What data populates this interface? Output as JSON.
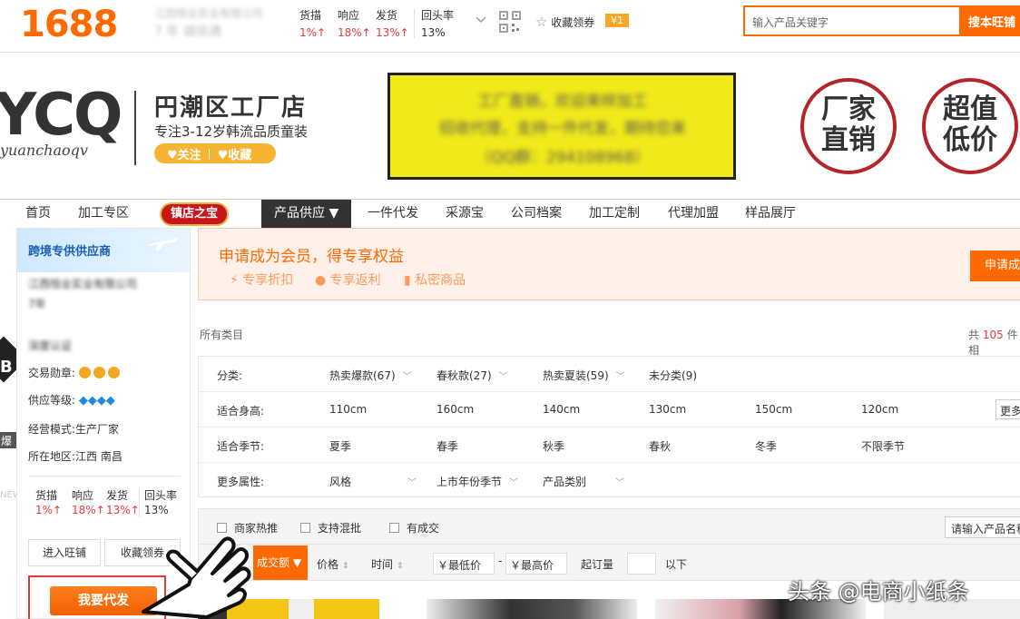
{
  "topbar": {
    "logo": "1688",
    "company_blurred": "江西恒业实业有限公司",
    "company_sub_blurred": "7 年  诚信通",
    "metrics": [
      {
        "label": "货描",
        "value": "1%↑"
      },
      {
        "label": "响应",
        "value": "18%↑"
      },
      {
        "label": "发货",
        "value": "13%↑"
      },
      {
        "label": "回头率",
        "value": "13%"
      }
    ],
    "favorite_label": "收藏领券",
    "coupon": "¥1",
    "search_placeholder": "输入产品关键字",
    "search_button": "搜本旺铺"
  },
  "banner": {
    "brand_big": "YCQ",
    "brand_script": "yuanchaoqv",
    "shop_name": "円潮区工厂店",
    "shop_desc": "专注3-12岁韩流品质童装",
    "follow": "♥关注",
    "collect": "♥收藏",
    "notice_lines_blurred": [
      "工厂直销，欢迎来样加工",
      "招收代理，支持一件代发，期待您来",
      "（QQ群：294108968）"
    ],
    "circle1": [
      "厂家",
      "直销"
    ],
    "circle2": [
      "超值",
      "低价"
    ]
  },
  "nav": {
    "items": [
      "首页",
      "加工专区",
      "镇店之宝",
      "产品供应 ▼",
      "一件代发",
      "采源宝",
      "公司档案",
      "加工定制",
      "代理加盟",
      "样品展厅"
    ]
  },
  "sidebar": {
    "header": "跨境专供供应商",
    "company_blurred": "江西恒业实业有限公司",
    "years_blurred": "7年",
    "license_blurred": "深度认证",
    "trade_medal_label": "交易勋章:",
    "supply_level_label": "供应等级:",
    "biz_mode": "经营模式:生产厂家",
    "location": "所在地区:江西 南昌",
    "metrics": [
      {
        "label": "货描",
        "value": "1%↑"
      },
      {
        "label": "响应",
        "value": "18%↑"
      },
      {
        "label": "发货",
        "value": "13%↑"
      },
      {
        "label": "回头率",
        "value": "13%"
      }
    ],
    "btn_wangpu": "进入旺铺",
    "btn_fav": "收藏领券",
    "btn_daifa": "我要代发",
    "edge_letter": "B",
    "edge_text1": "爆",
    "edge_text2": "NEW"
  },
  "promo": {
    "title": "申请成为会员，得专享权益",
    "perks": [
      "专享折扣",
      "专享返利",
      "私密商品"
    ],
    "button": "申请成"
  },
  "catalog": {
    "crumb": "所有类目",
    "total_prefix": "共",
    "total_count": "105",
    "total_suffix": "件相"
  },
  "filters": {
    "rows": [
      {
        "label": "分类:",
        "values": [
          "热卖爆款(67)",
          "春秋款(27)",
          "热卖夏装(59)",
          "未分类(9)"
        ]
      },
      {
        "label": "适合身高:",
        "values": [
          "110cm",
          "160cm",
          "140cm",
          "130cm",
          "150cm",
          "120cm"
        ],
        "more": "更多"
      },
      {
        "label": "适合季节:",
        "values": [
          "夏季",
          "春季",
          "秋季",
          "春秋",
          "冬季",
          "不限季节"
        ]
      },
      {
        "label": "更多属性:",
        "values": [
          "风格",
          "上市年份季节",
          "产品类别"
        ]
      }
    ]
  },
  "sortbar": {
    "checks": [
      "商家热推",
      "支持混批",
      "有成交"
    ],
    "search_placeholder": "请输入产品名称",
    "active_sort": "成交额 ▼",
    "price": "价格",
    "time": "时间",
    "price_min": "￥最低价",
    "dash": "-",
    "price_max": "￥最高价",
    "moq_label": "起订量",
    "moq_suffix": "以下"
  },
  "watermark": "头条 @电商小纸条",
  "colors": {
    "accent": "#ff6a00",
    "red": "#e4393c",
    "nav_dark": "#333333",
    "banner_yellow": "#f2ea1a",
    "circle_red": "#b5242a"
  }
}
